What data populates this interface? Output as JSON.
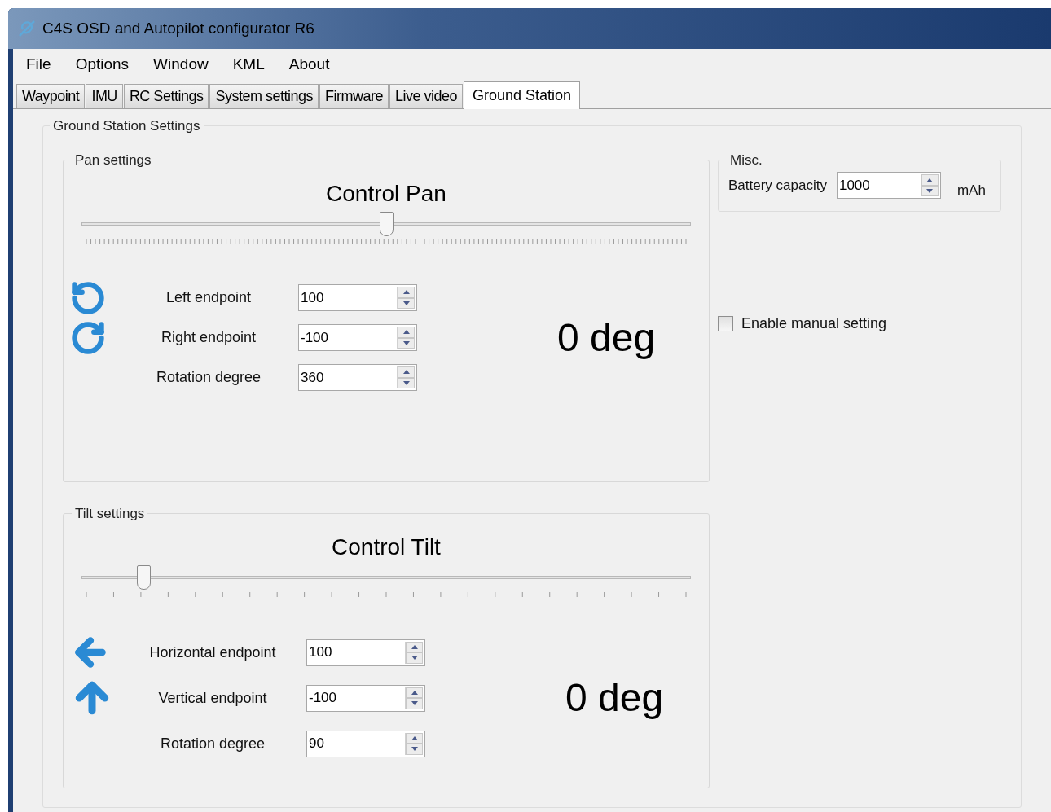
{
  "window": {
    "title": "C4S OSD and Autopilot configurator R6"
  },
  "menu": [
    "File",
    "Options",
    "Window",
    "KML",
    "About"
  ],
  "tabs": [
    {
      "label": "Waypoint",
      "selected": false
    },
    {
      "label": "IMU",
      "selected": false
    },
    {
      "label": "RC Settings",
      "selected": false
    },
    {
      "label": "System settings",
      "selected": false
    },
    {
      "label": "Firmware",
      "selected": false
    },
    {
      "label": "Live video",
      "selected": false
    },
    {
      "label": "Ground Station",
      "selected": true
    }
  ],
  "group": {
    "title": "Ground Station Settings",
    "sections": [
      {
        "kind": "pan",
        "title": "Pan settings",
        "heading": "Control Pan",
        "slider": {
          "level": 0.5
        },
        "reading": "0 deg",
        "fields": [
          {
            "label": "Left endpoint",
            "value": "100"
          },
          {
            "label": "Right endpoint",
            "value": "-100"
          },
          {
            "label": "Rotation degree",
            "value": "360"
          }
        ]
      },
      {
        "kind": "tilt",
        "title": "Tilt settings",
        "heading": "Control Tilt",
        "slider": {
          "level": 0.1
        },
        "reading": "0 deg",
        "fields": [
          {
            "label": "Horizontal endpoint",
            "value": "100"
          },
          {
            "label": "Vertical endpoint",
            "value": "-100"
          },
          {
            "label": "Rotation degree",
            "value": "90"
          }
        ]
      }
    ],
    "misc": {
      "title": "Misc.",
      "label": "Battery capacity",
      "value": "1000",
      "unit": "mAh"
    },
    "manual": {
      "label": "Enable manual setting",
      "checked": false
    }
  }
}
